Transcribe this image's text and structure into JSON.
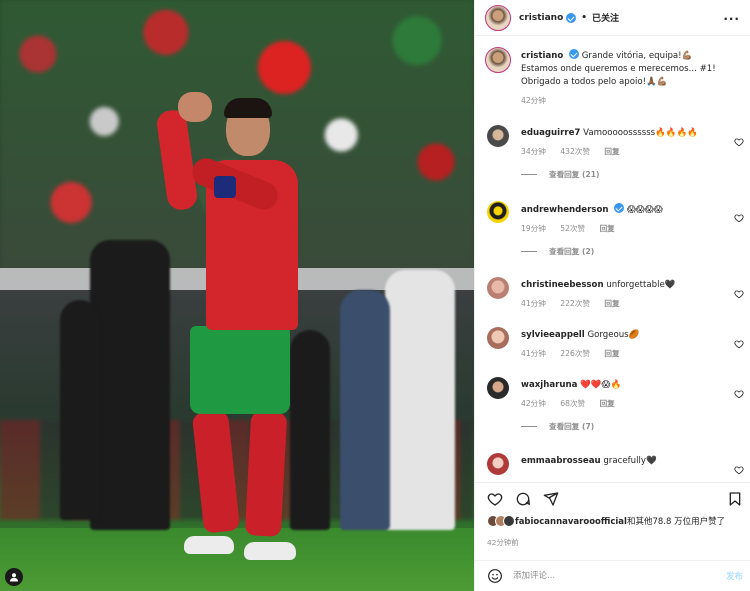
{
  "header": {
    "username": "cristiano",
    "separator": "•",
    "follow_label": "已关注",
    "more_label": "···"
  },
  "caption": {
    "username": "cristiano",
    "text": "Grande vitória, equipa!💪🏽 Estamos onde queremos e merecemos... #1! Obrigado a todos pelo apoio!🙏🏾💪🏽",
    "time": "42分钟"
  },
  "comments": [
    {
      "username": "eduaguirre7",
      "verified": false,
      "text": "Vamooooossssss🔥🔥🔥🔥",
      "time": "34分钟",
      "likes": "432次赞",
      "reply": "回复",
      "view_replies": "查看回复 (21)"
    },
    {
      "username": "andrewhenderson",
      "verified": true,
      "text": "😱😱😱😱",
      "time": "19分钟",
      "likes": "52次赞",
      "reply": "回复",
      "view_replies": "查看回复 (2)"
    },
    {
      "username": "christineebesson",
      "verified": false,
      "text": "unforgettable🖤",
      "time": "41分钟",
      "likes": "222次赞",
      "reply": "回复",
      "view_replies": ""
    },
    {
      "username": "sylvieeappell",
      "verified": false,
      "text": "Gorgeous🏉",
      "time": "41分钟",
      "likes": "226次赞",
      "reply": "回复",
      "view_replies": ""
    },
    {
      "username": "waxjharuna",
      "verified": false,
      "text": "❤️❤️😱🔥",
      "time": "42分钟",
      "likes": "68次赞",
      "reply": "回复",
      "view_replies": "查看回复 (7)"
    },
    {
      "username": "emmaabrosseau",
      "verified": false,
      "text": "gracefully🖤",
      "time": "",
      "likes": "",
      "reply": "",
      "view_replies": ""
    }
  ],
  "likes": {
    "liker": "fabiocannavarooofficial",
    "suffix": "和其他78.8 万位用户赞了"
  },
  "posted_ago": "42分钟前",
  "comment_box": {
    "placeholder": "添加评论...",
    "post_label": "发布"
  },
  "icons": {
    "like": "heart-icon",
    "comment": "comment-icon",
    "share": "send-icon",
    "save": "bookmark-icon",
    "emoji": "emoji-icon",
    "user_tag": "user-tag-icon"
  },
  "colors": {
    "verified": "#3897f0",
    "post_disabled": "#b2dffc",
    "muted": "#8e8e8e"
  }
}
